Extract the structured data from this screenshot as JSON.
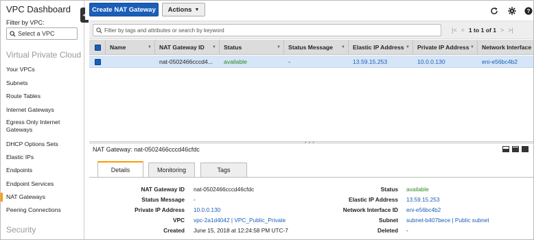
{
  "sidebar": {
    "title": "VPC Dashboard",
    "filter_label": "Filter by VPC:",
    "vpc_select_placeholder": "Select a VPC",
    "section_vpc": "Virtual Private Cloud",
    "items": [
      {
        "label": "Your VPCs"
      },
      {
        "label": "Subnets"
      },
      {
        "label": "Route Tables"
      },
      {
        "label": "Internet Gateways"
      },
      {
        "label": "Egress Only Internet Gateways"
      },
      {
        "label": "DHCP Options Sets"
      },
      {
        "label": "Elastic IPs"
      },
      {
        "label": "Endpoints"
      },
      {
        "label": "Endpoint Services"
      },
      {
        "label": "NAT Gateways"
      },
      {
        "label": "Peering Connections"
      }
    ],
    "active_item": "NAT Gateways",
    "section_security": "Security"
  },
  "toolbar": {
    "create_label": "Create NAT Gateway",
    "actions_label": "Actions"
  },
  "filter": {
    "placeholder": "Filter by tags and attributes or search by keyword"
  },
  "pager": {
    "text": "1 to 1 of 1"
  },
  "table": {
    "columns": [
      "Name",
      "NAT Gateway ID",
      "Status",
      "Status Message",
      "Elastic IP Address",
      "Private IP Address",
      "Network Interface"
    ],
    "rows": [
      {
        "name": "",
        "nat_gateway_id": "nat-0502466cccd4...",
        "status": "available",
        "status_message": "-",
        "elastic_ip": "13.59.15.253",
        "private_ip": "10.0.0.130",
        "network_interface": "eni-e56bc4b2"
      }
    ]
  },
  "details": {
    "header_label": "NAT Gateway:",
    "header_value": "nat-0502466cccd46cfdc",
    "tabs": [
      "Details",
      "Monitoring",
      "Tags"
    ],
    "left": [
      {
        "label": "NAT Gateway ID",
        "value": "nat-0502466cccd46cfdc"
      },
      {
        "label": "Status Message",
        "value": "-"
      },
      {
        "label": "Private IP Address",
        "value": "10.0.0.130"
      },
      {
        "label": "VPC",
        "value": "vpc-2a1d4042 | VPC_Public_Private"
      },
      {
        "label": "Created",
        "value": "June 15, 2018 at 12:24:58 PM UTC-7"
      }
    ],
    "right": [
      {
        "label": "Status",
        "value": "available"
      },
      {
        "label": "Elastic IP Address",
        "value": "13.59.15.253"
      },
      {
        "label": "Network Interface ID",
        "value": "eni-e56bc4b2"
      },
      {
        "label": "Subnet",
        "value": "subnet-b407bece | Public subnet"
      },
      {
        "label": "Deleted",
        "value": "-"
      }
    ]
  },
  "icons": {
    "refresh": "refresh-icon",
    "settings": "gear-icon",
    "help": "help-icon",
    "search": "search-icon"
  },
  "colors": {
    "primary": "#1a5eb8",
    "accent": "#ff9900",
    "status_available": "#2a8a1c",
    "selected_row": "#d6e5f7"
  }
}
